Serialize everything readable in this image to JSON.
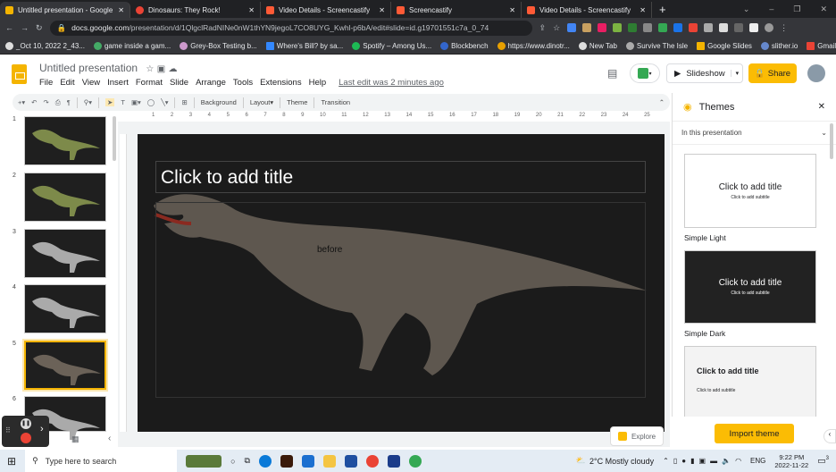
{
  "browser": {
    "tabs": [
      {
        "title": "Untitled presentation - Google Sl",
        "color": "#f4b400",
        "active": true
      },
      {
        "title": "Dinosaurs: They Rock!",
        "color": "#ea4335"
      },
      {
        "title": "Video Details - Screencastify",
        "color": "#ff5a36"
      },
      {
        "title": "Screencastify",
        "color": "#ff5a36"
      },
      {
        "title": "Video Details - Screencastify",
        "color": "#ff5a36"
      }
    ],
    "new_tab": "+",
    "url_domain": "docs.google.com",
    "url_path": "/presentation/d/1QlgclRadNINe0nW1thYN9jegoL7CO8UYG_Kwhl-p6bA/edit#slide=id.g19701551c7a_0_74",
    "bookmarks": [
      "_Oct 10, 2022 2_43...",
      "game inside a gam...",
      "Grey-Box Testing b...",
      "Where's Bill? by sa...",
      "Spotify – Among Us...",
      "Blockbench",
      "https://www.dinotr...",
      "New Tab",
      "Survive The Isle",
      "Google Slides",
      "slither.io",
      "Gmail"
    ]
  },
  "app": {
    "title": "Untitled presentation",
    "menus": [
      "File",
      "Edit",
      "View",
      "Insert",
      "Format",
      "Slide",
      "Arrange",
      "Tools",
      "Extensions",
      "Help"
    ],
    "last_edit": "Last edit was 2 minutes ago",
    "slideshow": "Slideshow",
    "share": "Share",
    "toolbar": {
      "background": "Background",
      "layout": "Layout",
      "theme": "Theme",
      "transition": "Transition"
    },
    "ruler": [
      "1",
      "2",
      "3",
      "4",
      "5",
      "6",
      "7",
      "8",
      "9",
      "10",
      "11",
      "12",
      "13",
      "14",
      "15",
      "16",
      "17",
      "18",
      "19",
      "20",
      "21",
      "22",
      "23",
      "24",
      "25"
    ]
  },
  "slides": [
    "1",
    "2",
    "3",
    "4",
    "5",
    "6"
  ],
  "slide": {
    "title_placeholder": "Click to add title",
    "body_text": "before"
  },
  "themes": {
    "title": "Themes",
    "section": "In this presentation",
    "cards": [
      {
        "name": "Simple Light",
        "title": "Click to add title",
        "subtitle": "Click to add subtitle"
      },
      {
        "name": "Simple Dark",
        "title": "Click to add title",
        "subtitle": "Click to add subtitle"
      },
      {
        "title": "Click to add title",
        "subtitle": "Click to add subtitle"
      }
    ],
    "import": "Import theme"
  },
  "explore": "Explore",
  "taskbar": {
    "search": "Type here to search",
    "weather": "2°C  Mostly cloudy",
    "lang": "ENG",
    "time": "9:22 PM",
    "date": "2022-11-22",
    "notifications": "3"
  }
}
